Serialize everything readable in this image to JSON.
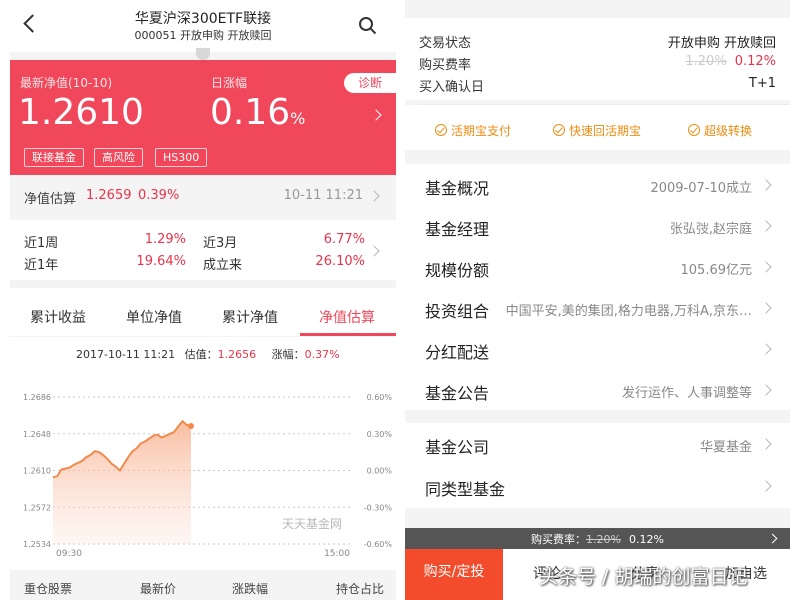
{
  "left": {
    "header": {
      "title": "华夏沪深300ETF联接",
      "subtitle": "000051 开放申购 开放赎回"
    },
    "banner": {
      "nav_label": "最新净值(10-10)",
      "nav_value": "1.2610",
      "change_label": "日涨幅",
      "change_value": "0.16",
      "change_unit": "%",
      "diagnose_button": "诊断",
      "tags": [
        "联接基金",
        "高风险",
        "HS300"
      ],
      "color": "#f0475a"
    },
    "estimate": {
      "label": "净值估算",
      "value": "1.2659",
      "change": "0.39%",
      "time": "10-11 11:21"
    },
    "perf": {
      "items": [
        {
          "label": "近1周",
          "value": "1.29%"
        },
        {
          "label": "近3月",
          "value": "6.77%"
        },
        {
          "label": "近1年",
          "value": "19.64%"
        },
        {
          "label": "成立来",
          "value": "26.10%"
        }
      ]
    },
    "tabs": [
      "累计收益",
      "单位净值",
      "累计净值",
      "净值估算"
    ],
    "active_tab": 3,
    "chart_header": {
      "datetime": "2017-10-11 11:21",
      "est_label": "估值：",
      "est_value": "1.2656",
      "chg_label": "涨幅：",
      "chg_value": "0.37%"
    },
    "watermark": "天天基金网",
    "holdings_header": [
      "重仓股票",
      "最新价",
      "涨跌幅",
      "持仓占比"
    ]
  },
  "chart_data": {
    "type": "area",
    "x_ticks": [
      "09:30",
      "15:00"
    ],
    "ylim": [
      1.2534,
      1.2686
    ],
    "y_ticks_left": [
      "1.2686",
      "1.2648",
      "1.2610",
      "1.2572",
      "1.2534"
    ],
    "y_ticks_right": [
      "0.60%",
      "0.30%",
      "0.00%",
      "-0.30%",
      "-0.60%"
    ],
    "y": [
      1.2603,
      1.2604,
      1.2611,
      1.2612,
      1.2613,
      1.2616,
      1.2618,
      1.262,
      1.2624,
      1.2626,
      1.263,
      1.2629,
      1.2626,
      1.2622,
      1.2617,
      1.2614,
      1.261,
      1.2617,
      1.2624,
      1.263,
      1.2633,
      1.2638,
      1.264,
      1.2643,
      1.2646,
      1.2647,
      1.2644,
      1.2646,
      1.2648,
      1.265,
      1.2656,
      1.2661,
      1.2657,
      1.2656
    ],
    "color": "#f28a4b",
    "grid": true
  },
  "right": {
    "trade": [
      {
        "label": "交易状态",
        "value": "开放申购 开放赎回"
      },
      {
        "label": "购买费率",
        "old": "1.20%",
        "value": "0.12%"
      },
      {
        "label": "买入确认日",
        "value": "T+1"
      }
    ],
    "features": [
      "活期宝支付",
      "快速回活期宝",
      "超级转换"
    ],
    "info": [
      {
        "label": "基金概况",
        "value": "2009-07-10成立"
      },
      {
        "label": "基金经理",
        "value": "张弘弢,赵宗庭"
      },
      {
        "label": "规模份额",
        "value": "105.69亿元"
      },
      {
        "label": "投资组合",
        "value": "中国平安,美的集团,格力电器,万科A,京东…"
      },
      {
        "label": "分红配送",
        "value": ""
      },
      {
        "label": "基金公告",
        "value": "发行运作、人事调整等"
      }
    ],
    "info2": [
      {
        "label": "基金公司",
        "value": "华夏基金"
      },
      {
        "label": "同类型基金",
        "value": ""
      }
    ],
    "fee_bar": {
      "label": "购买费率：",
      "old": "1.20%",
      "value": "0.12%"
    },
    "bottom": {
      "buy": "购买/定投",
      "comment": "评论",
      "share": "分享",
      "selfpick": "加自选"
    },
    "watermark": "头条号 / 胡瑞的创富日记"
  }
}
